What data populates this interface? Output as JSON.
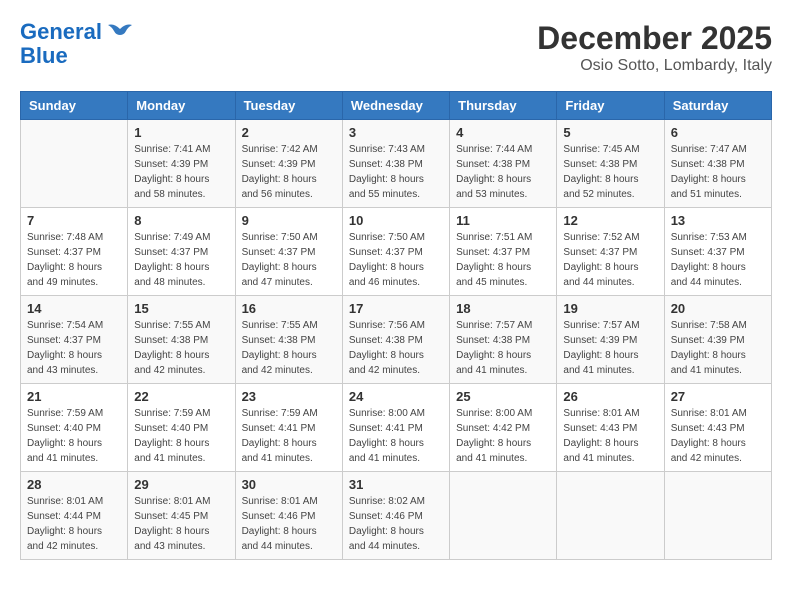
{
  "header": {
    "logo_line1": "General",
    "logo_line2": "Blue",
    "title": "December 2025",
    "subtitle": "Osio Sotto, Lombardy, Italy"
  },
  "calendar": {
    "days_of_week": [
      "Sunday",
      "Monday",
      "Tuesday",
      "Wednesday",
      "Thursday",
      "Friday",
      "Saturday"
    ],
    "weeks": [
      [
        {
          "day": "",
          "info": ""
        },
        {
          "day": "1",
          "info": "Sunrise: 7:41 AM\nSunset: 4:39 PM\nDaylight: 8 hours\nand 58 minutes."
        },
        {
          "day": "2",
          "info": "Sunrise: 7:42 AM\nSunset: 4:39 PM\nDaylight: 8 hours\nand 56 minutes."
        },
        {
          "day": "3",
          "info": "Sunrise: 7:43 AM\nSunset: 4:38 PM\nDaylight: 8 hours\nand 55 minutes."
        },
        {
          "day": "4",
          "info": "Sunrise: 7:44 AM\nSunset: 4:38 PM\nDaylight: 8 hours\nand 53 minutes."
        },
        {
          "day": "5",
          "info": "Sunrise: 7:45 AM\nSunset: 4:38 PM\nDaylight: 8 hours\nand 52 minutes."
        },
        {
          "day": "6",
          "info": "Sunrise: 7:47 AM\nSunset: 4:38 PM\nDaylight: 8 hours\nand 51 minutes."
        }
      ],
      [
        {
          "day": "7",
          "info": "Sunrise: 7:48 AM\nSunset: 4:37 PM\nDaylight: 8 hours\nand 49 minutes."
        },
        {
          "day": "8",
          "info": "Sunrise: 7:49 AM\nSunset: 4:37 PM\nDaylight: 8 hours\nand 48 minutes."
        },
        {
          "day": "9",
          "info": "Sunrise: 7:50 AM\nSunset: 4:37 PM\nDaylight: 8 hours\nand 47 minutes."
        },
        {
          "day": "10",
          "info": "Sunrise: 7:50 AM\nSunset: 4:37 PM\nDaylight: 8 hours\nand 46 minutes."
        },
        {
          "day": "11",
          "info": "Sunrise: 7:51 AM\nSunset: 4:37 PM\nDaylight: 8 hours\nand 45 minutes."
        },
        {
          "day": "12",
          "info": "Sunrise: 7:52 AM\nSunset: 4:37 PM\nDaylight: 8 hours\nand 44 minutes."
        },
        {
          "day": "13",
          "info": "Sunrise: 7:53 AM\nSunset: 4:37 PM\nDaylight: 8 hours\nand 44 minutes."
        }
      ],
      [
        {
          "day": "14",
          "info": "Sunrise: 7:54 AM\nSunset: 4:37 PM\nDaylight: 8 hours\nand 43 minutes."
        },
        {
          "day": "15",
          "info": "Sunrise: 7:55 AM\nSunset: 4:38 PM\nDaylight: 8 hours\nand 42 minutes."
        },
        {
          "day": "16",
          "info": "Sunrise: 7:55 AM\nSunset: 4:38 PM\nDaylight: 8 hours\nand 42 minutes."
        },
        {
          "day": "17",
          "info": "Sunrise: 7:56 AM\nSunset: 4:38 PM\nDaylight: 8 hours\nand 42 minutes."
        },
        {
          "day": "18",
          "info": "Sunrise: 7:57 AM\nSunset: 4:38 PM\nDaylight: 8 hours\nand 41 minutes."
        },
        {
          "day": "19",
          "info": "Sunrise: 7:57 AM\nSunset: 4:39 PM\nDaylight: 8 hours\nand 41 minutes."
        },
        {
          "day": "20",
          "info": "Sunrise: 7:58 AM\nSunset: 4:39 PM\nDaylight: 8 hours\nand 41 minutes."
        }
      ],
      [
        {
          "day": "21",
          "info": "Sunrise: 7:59 AM\nSunset: 4:40 PM\nDaylight: 8 hours\nand 41 minutes."
        },
        {
          "day": "22",
          "info": "Sunrise: 7:59 AM\nSunset: 4:40 PM\nDaylight: 8 hours\nand 41 minutes."
        },
        {
          "day": "23",
          "info": "Sunrise: 7:59 AM\nSunset: 4:41 PM\nDaylight: 8 hours\nand 41 minutes."
        },
        {
          "day": "24",
          "info": "Sunrise: 8:00 AM\nSunset: 4:41 PM\nDaylight: 8 hours\nand 41 minutes."
        },
        {
          "day": "25",
          "info": "Sunrise: 8:00 AM\nSunset: 4:42 PM\nDaylight: 8 hours\nand 41 minutes."
        },
        {
          "day": "26",
          "info": "Sunrise: 8:01 AM\nSunset: 4:43 PM\nDaylight: 8 hours\nand 41 minutes."
        },
        {
          "day": "27",
          "info": "Sunrise: 8:01 AM\nSunset: 4:43 PM\nDaylight: 8 hours\nand 42 minutes."
        }
      ],
      [
        {
          "day": "28",
          "info": "Sunrise: 8:01 AM\nSunset: 4:44 PM\nDaylight: 8 hours\nand 42 minutes."
        },
        {
          "day": "29",
          "info": "Sunrise: 8:01 AM\nSunset: 4:45 PM\nDaylight: 8 hours\nand 43 minutes."
        },
        {
          "day": "30",
          "info": "Sunrise: 8:01 AM\nSunset: 4:46 PM\nDaylight: 8 hours\nand 44 minutes."
        },
        {
          "day": "31",
          "info": "Sunrise: 8:02 AM\nSunset: 4:46 PM\nDaylight: 8 hours\nand 44 minutes."
        },
        {
          "day": "",
          "info": ""
        },
        {
          "day": "",
          "info": ""
        },
        {
          "day": "",
          "info": ""
        }
      ]
    ]
  }
}
